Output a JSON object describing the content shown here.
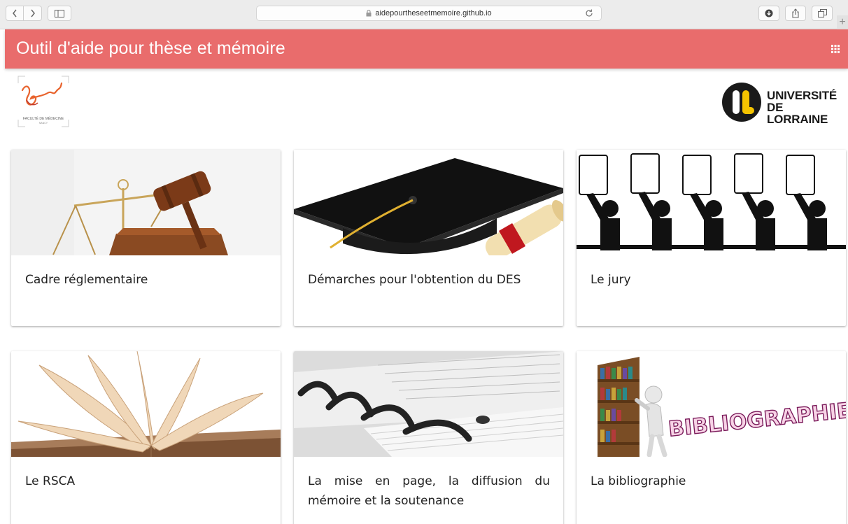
{
  "browser": {
    "url": "aidepourtheseetmemoire.github.io",
    "back_icon": "chevron-left",
    "forward_icon": "chevron-right",
    "new_tab_label": "+"
  },
  "header": {
    "title": "Outil d'aide pour thèse et mémoire",
    "background_color": "#e96c6c",
    "menu_icon": "apps-grid"
  },
  "logos": {
    "faculty": {
      "line1": "FACULTÉ DE MÉDECINE",
      "line2": "NANCY"
    },
    "university": {
      "line1": "UNIVERSITÉ",
      "line2": "DE LORRAINE"
    }
  },
  "cards": [
    {
      "title": "Cadre réglementaire",
      "image": "gavel-and-scales"
    },
    {
      "title": "Démarches pour l'obtention du DES",
      "image": "graduation-cap-and-diploma"
    },
    {
      "title": "Le jury",
      "image": "jury-holding-score-cards"
    },
    {
      "title": "Le RSCA",
      "image": "open-book"
    },
    {
      "title": "La mise en page, la diffusion du mémoire et la soutenance",
      "image": "spiral-binding"
    },
    {
      "title": "La bibliographie",
      "image": "bookshelf-bibliographie",
      "image_text": "BIBLIOGRAPHIE"
    }
  ]
}
